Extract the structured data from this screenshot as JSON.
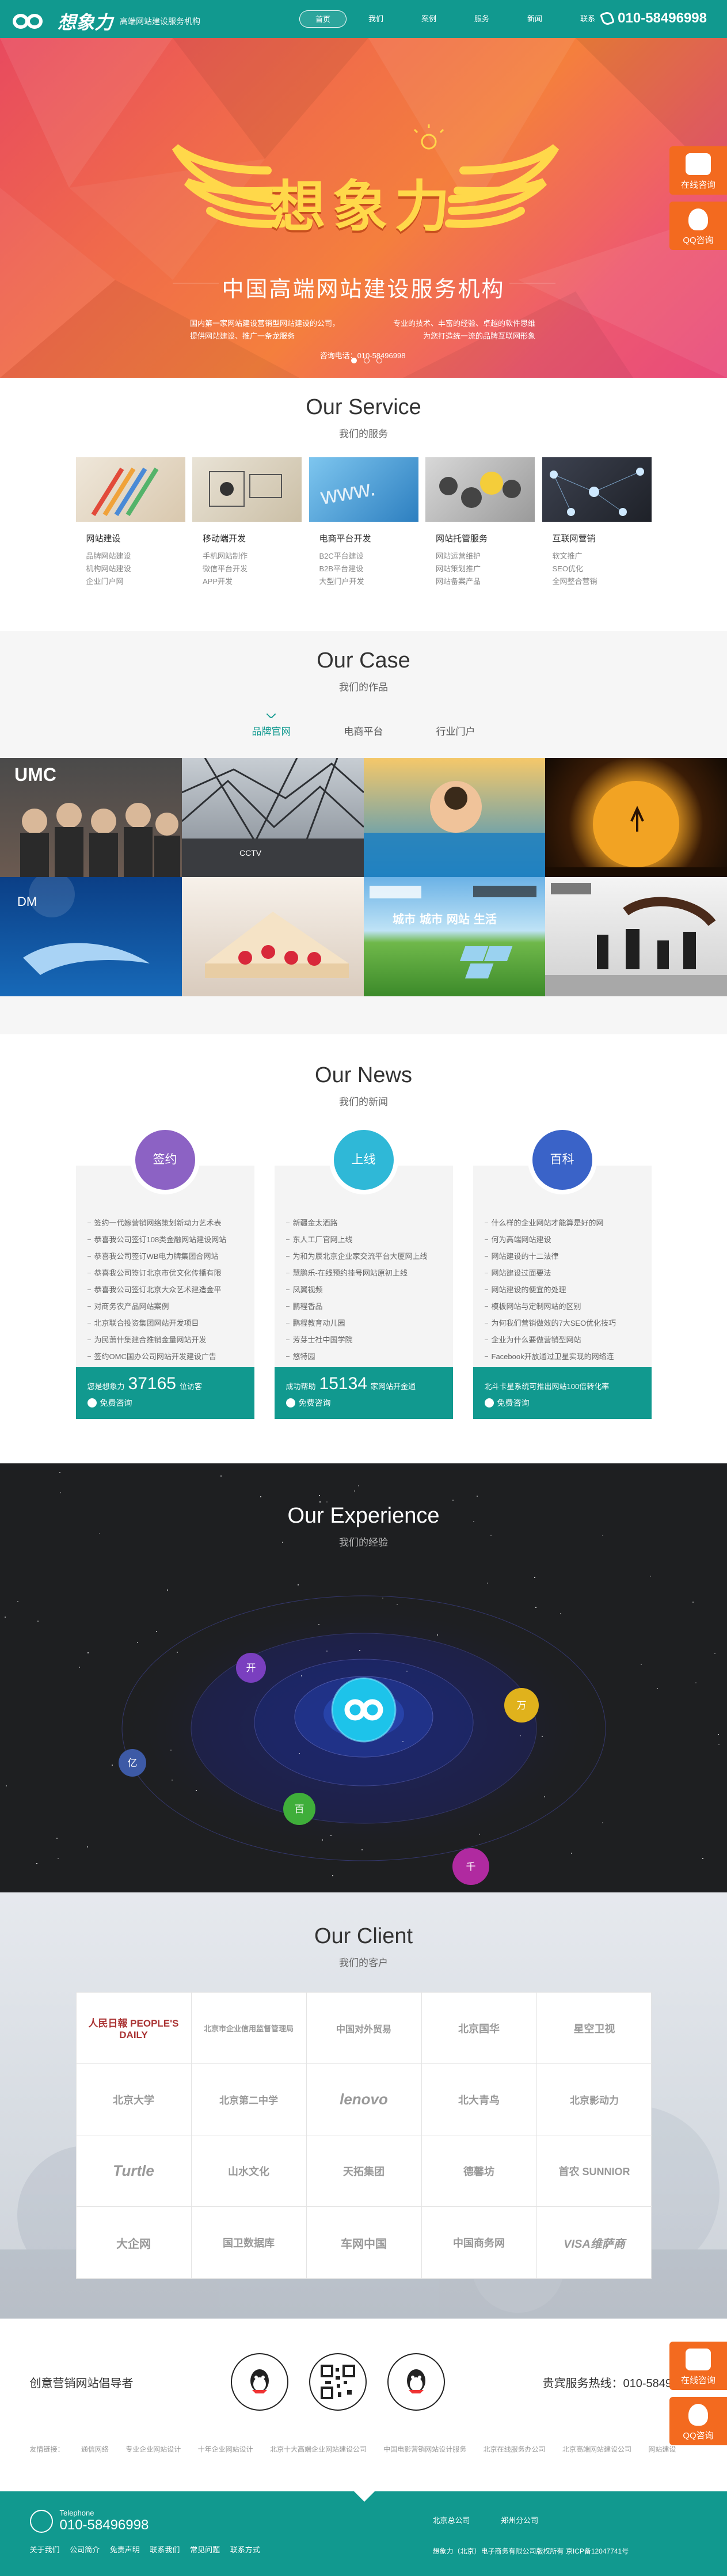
{
  "header": {
    "brand": "想象力",
    "slogan": "高端网站建设服务机构",
    "nav": [
      "首页",
      "我们",
      "案例",
      "服务",
      "新闻",
      "联系"
    ],
    "phone": "010-58496998"
  },
  "banner": {
    "title": "想象力",
    "subtitle": "中国高端网站建设服务机构",
    "desc_left_1": "国内第一家网站建设营销型网站建设的公司，",
    "desc_right_1": "专业的技术、丰富的经验、卓越的软件思维",
    "desc_left_2": "提供网站建设、推广一条龙服务",
    "desc_right_2": "为您打造统一流的品牌互联网形象",
    "tel": "咨询电话：010-58496998"
  },
  "float": {
    "online": "在线咨询",
    "qq": "QQ咨询"
  },
  "service": {
    "en": "Our Service",
    "cn": "我们的服务",
    "items": [
      {
        "title": "网站建设",
        "lines": [
          "品牌网站建设",
          "机构网站建设",
          "企业门户网"
        ]
      },
      {
        "title": "移动端开发",
        "lines": [
          "手机网站制作",
          "微信平台开发",
          "APP开发"
        ]
      },
      {
        "title": "电商平台开发",
        "lines": [
          "B2C平台建设",
          "B2B平台建设",
          "大型门户开发"
        ]
      },
      {
        "title": "网站托管服务",
        "lines": [
          "网站运营维护",
          "网站策划推广",
          "网站备案产品"
        ]
      },
      {
        "title": "互联网营销",
        "lines": [
          "软文推广",
          "SEO优化",
          "全网整合营销"
        ]
      }
    ]
  },
  "case": {
    "en": "Our Case",
    "cn": "我们的作品",
    "tabs": [
      "品牌官网",
      "电商平台",
      "行业门户"
    ],
    "overlay_text": "城市 城市 网站 生活"
  },
  "news": {
    "en": "Our News",
    "cn": "我们的新闻",
    "cols": [
      {
        "tag": "签约",
        "color": "#8c62c4",
        "items": [
          "签约一代嫁营销网络策划新动力艺术表",
          "恭喜我公司签订108类金融网站建设网站",
          "恭喜我公司签订WB电力牌集团合网站",
          "恭喜我公司签订北京市优文化传播有限",
          "恭喜我公司签订北京大众艺术建造金平",
          "对商务农产品网站案例",
          "北京联合投资集团网站开发项目",
          "为民萧什集建合推销金量网站开发",
          "签约OMC国办公司网站开发建设广告"
        ],
        "stat_pre": "您是想象力",
        "stat_num": "37165",
        "stat_post": "位访客",
        "consult": "免费咨询"
      },
      {
        "tag": "上线",
        "color": "#2fb8d7",
        "items": [
          "新疆金太酒路",
          "东人工厂官网上线",
          "为和为辰北京企业家交流平台大厦网上线",
          "慧鹏乐-在线预约挂号网站原初上线",
          "凤翼视频",
          "鹏程香品",
          "鹏程教育动儿园",
          "芳芽士社中国学院",
          "悠特园"
        ],
        "stat_pre": "成功帮助",
        "stat_num": "15134",
        "stat_post": "家网站开金通",
        "consult": "免费咨询"
      },
      {
        "tag": "百科",
        "color": "#3a63c8",
        "items": [
          "什么样的企业网站才能算是好的网",
          "何为高端网站建设",
          "网站建设的十二法律",
          "网站建设过面要法",
          "网站建设的便宜的处理",
          "模板网站与定制网站的区别",
          "为何我们营销做效的7大SEO优化技巧",
          "企业为什么要做营销型网站",
          "Facebook开放通过卫星实现的网络连"
        ],
        "stat_pre": "北斗卡星系统可推出网站100倍转化率",
        "stat_num": "",
        "stat_post": "",
        "consult": "免费咨询"
      }
    ]
  },
  "experience": {
    "en": "Our Experience",
    "cn": "我们的经验",
    "planets": [
      {
        "label": "开",
        "color": "#7a3fbf"
      },
      {
        "label": "亿",
        "color": "#3d5aa6"
      },
      {
        "label": "万",
        "color": "#e0b21c"
      },
      {
        "label": "百",
        "color": "#3fae3a"
      },
      {
        "label": "千",
        "color": "#b02aa0"
      }
    ]
  },
  "client": {
    "en": "Our Client",
    "cn": "我们的客户",
    "logos": [
      "人民日報 PEOPLE'S DAILY",
      "北京市企业信用监督管理局",
      "中国对外贸易",
      "北京国华",
      "星空卫视",
      "北京大学",
      "北京第二中学",
      "lenovo",
      "北大青鸟",
      "北京影动力",
      "Turtle",
      "山水文化",
      "天拓集团",
      "德馨坊",
      "首农 SUNNIOR",
      "大企网",
      "国卫数据库",
      "车网中国",
      "中国商务网",
      "VISA维萨商"
    ]
  },
  "contact": {
    "left": "创意营销网站倡导者",
    "right": "贵宾服务热线：010-58496998",
    "links": [
      "友情链接：",
      "通信网络",
      "专业企业网站设计",
      "十年企业网站设计",
      "北京十大高端企业网站建设公司",
      "中国电影营销网站设计服务",
      "北京在线服务办公司",
      "北京高端网站建设公司",
      "网站建设"
    ]
  },
  "footer": {
    "tel_label": "Telephone",
    "tel": "010-58496998",
    "nav": [
      "关于我们",
      "公司简介",
      "免责声明",
      "联系我们",
      "常见问题",
      "联系方式"
    ],
    "company": [
      "北京总公司",
      "郑州分公司"
    ],
    "copy": "想象力（北京）电子商务有限公司版权所有 京ICP备12047741号"
  }
}
